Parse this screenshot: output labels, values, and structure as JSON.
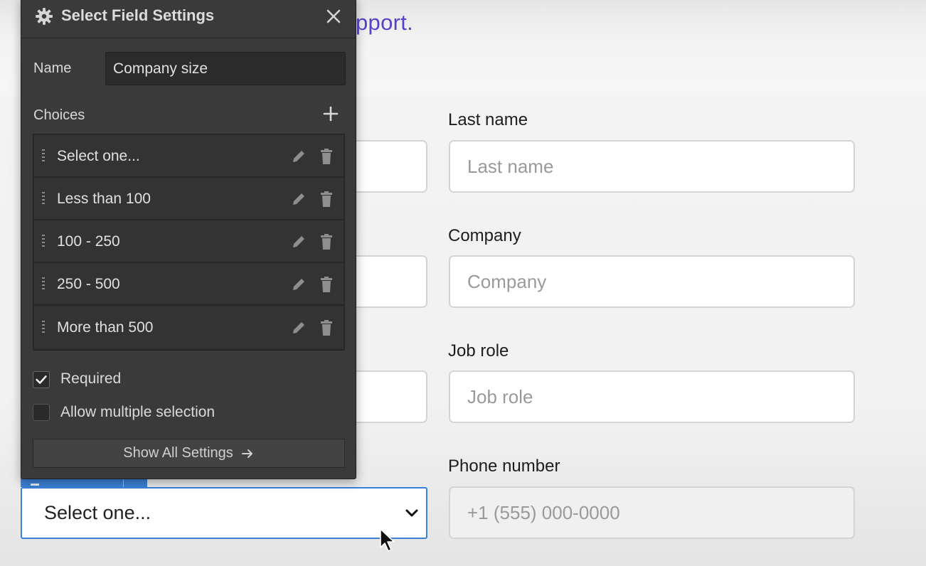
{
  "page": {
    "top_link_text": "pport."
  },
  "form": {
    "last_name_label": "Last name",
    "last_name_placeholder": "Last name",
    "company_label": "Company",
    "company_placeholder": "Company",
    "job_role_label": "Job role",
    "job_role_placeholder": "Job role",
    "phone_label": "Phone number",
    "phone_placeholder": "+1 (555) 000-0000",
    "select_value": "Select one..."
  },
  "panel": {
    "title": "Select Field Settings",
    "name_label": "Name",
    "name_value": "Company size",
    "choices_label": "Choices",
    "choices": [
      "Select one...",
      "Less than 100",
      "100 - 250",
      "250 - 500",
      "More than 500"
    ],
    "required_label": "Required",
    "required_checked": true,
    "multiple_label": "Allow multiple selection",
    "multiple_checked": false,
    "show_all_label": "Show All Settings"
  },
  "icons": {
    "gear": "gear-icon",
    "close": "close-icon",
    "add": "plus-icon",
    "drag": "drag-handle-icon",
    "edit": "pencil-icon",
    "delete": "trash-icon",
    "arrow": "arrow-right-icon",
    "chevron": "chevron-down-icon",
    "cursor": "cursor-icon"
  },
  "colors": {
    "link": "#5a3fc8",
    "selection_blue": "#3b82d8",
    "panel_bg": "#3a3a3a"
  }
}
